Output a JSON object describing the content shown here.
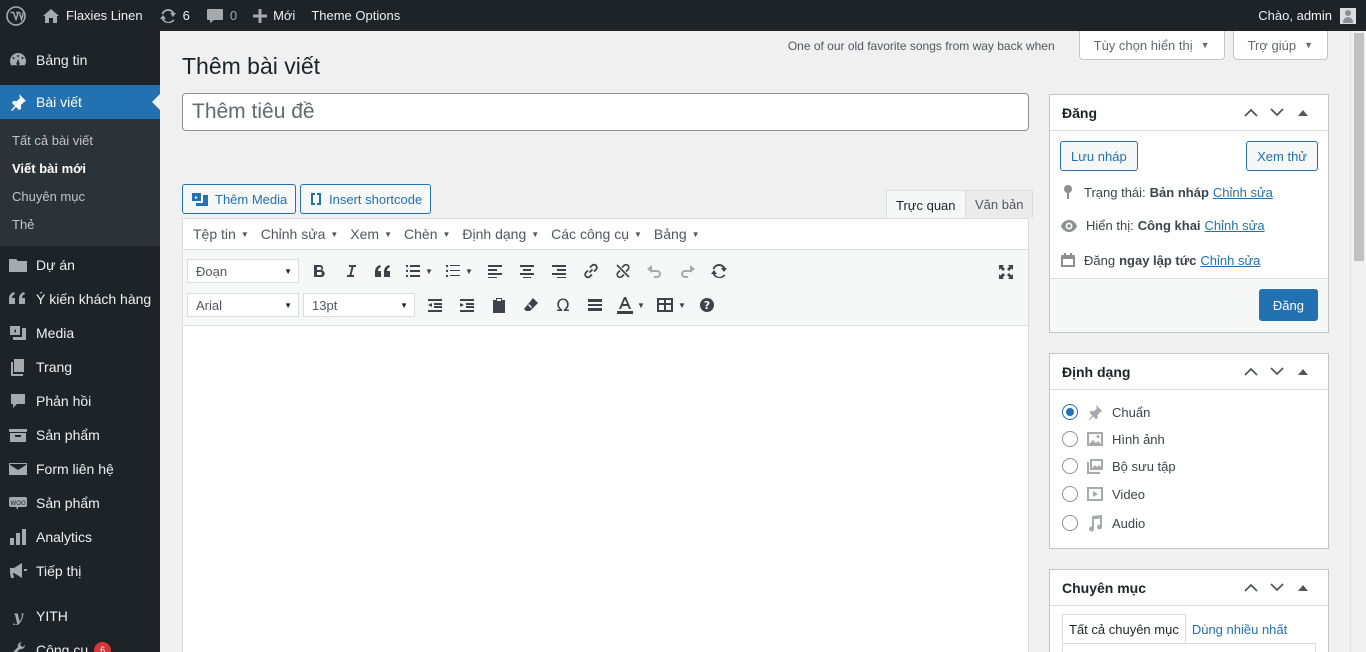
{
  "adminbar": {
    "site_name": "Flaxies Linen",
    "updates_count": "6",
    "comments_count": "0",
    "new_label": "Mới",
    "theme_options": "Theme Options",
    "greeting": "Chào, admin"
  },
  "sidebar": {
    "dashboard": "Bảng tin",
    "posts": "Bài viết",
    "posts_sub": [
      "Tất cả bài viết",
      "Viết bài mới",
      "Chuyên mục",
      "Thẻ"
    ],
    "items": [
      "Dự án",
      "Ý kiến khách hàng",
      "Media",
      "Trang",
      "Phản hồi",
      "Sản phẩm",
      "Form liên hệ",
      "Sản phẩm",
      "Analytics",
      "Tiếp thị",
      "YITH",
      "Công cụ"
    ],
    "tools_badge": "6"
  },
  "header": {
    "hello_dolly": "One of our old favorite songs from way back when",
    "screen_options": "Tùy chọn hiển thị",
    "help": "Trợ giúp",
    "page_title": "Thêm bài viết"
  },
  "editor": {
    "title_placeholder": "Thêm tiêu đề",
    "add_media": "Thêm Media",
    "insert_shortcode": "Insert shortcode",
    "tab_visual": "Trực quan",
    "tab_text": "Văn bản",
    "menus": [
      "Tệp tin",
      "Chỉnh sửa",
      "Xem",
      "Chèn",
      "Định dạng",
      "Các công cụ",
      "Bảng"
    ],
    "format_select": "Đoạn",
    "font_family": "Arial",
    "font_size": "13pt"
  },
  "publish_box": {
    "title": "Đăng",
    "save_draft": "Lưu nháp",
    "preview": "Xem thử",
    "status_label": "Trạng thái:",
    "status_value": "Bản nháp",
    "visibility_label": "Hiển thị:",
    "visibility_value": "Công khai",
    "schedule_label": "Đăng",
    "schedule_value": "ngay lập tức",
    "edit_link": "Chỉnh sửa",
    "publish": "Đăng"
  },
  "format_box": {
    "title": "Định dạng",
    "options": [
      "Chuẩn",
      "Hình ảnh",
      "Bộ sưu tập",
      "Video",
      "Audio"
    ],
    "selected": "Chuẩn"
  },
  "category_box": {
    "title": "Chuyên mục",
    "tab_all": "Tất cả chuyên mục",
    "tab_popular": "Dùng nhiều nhất"
  },
  "colors": {
    "adminbar_bg": "#1d2327",
    "accent": "#2271b1",
    "badge": "#d63638"
  }
}
